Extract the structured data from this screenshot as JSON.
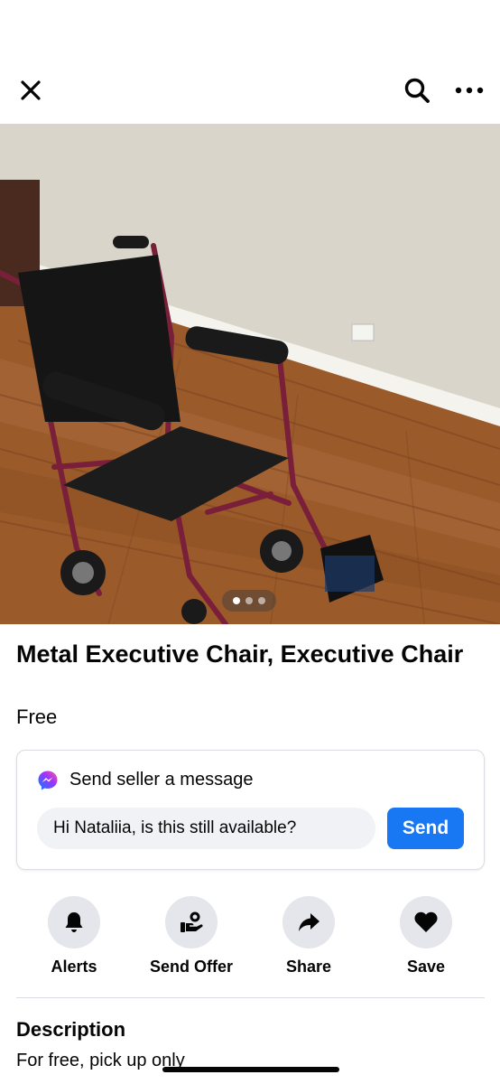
{
  "header": {
    "close_icon": "close-icon",
    "search_icon": "search-icon",
    "more_icon": "more-horizontal-icon"
  },
  "gallery": {
    "image_subject": "wheelchair",
    "page_count": 3,
    "current_page": 1
  },
  "listing": {
    "title": "Metal Executive Chair, Executive Chair",
    "price": "Free"
  },
  "message_card": {
    "heading": "Send seller a message",
    "input_value": "Hi Nataliia, is this still available?",
    "send_label": "Send",
    "accent_color": "#1877f2"
  },
  "actions": [
    {
      "label": "Alerts",
      "icon": "bell-icon"
    },
    {
      "label": "Send Offer",
      "icon": "offer-icon"
    },
    {
      "label": "Share",
      "icon": "share-icon"
    },
    {
      "label": "Save",
      "icon": "heart-icon"
    }
  ],
  "description": {
    "heading": "Description",
    "text": "For free, pick up only"
  }
}
